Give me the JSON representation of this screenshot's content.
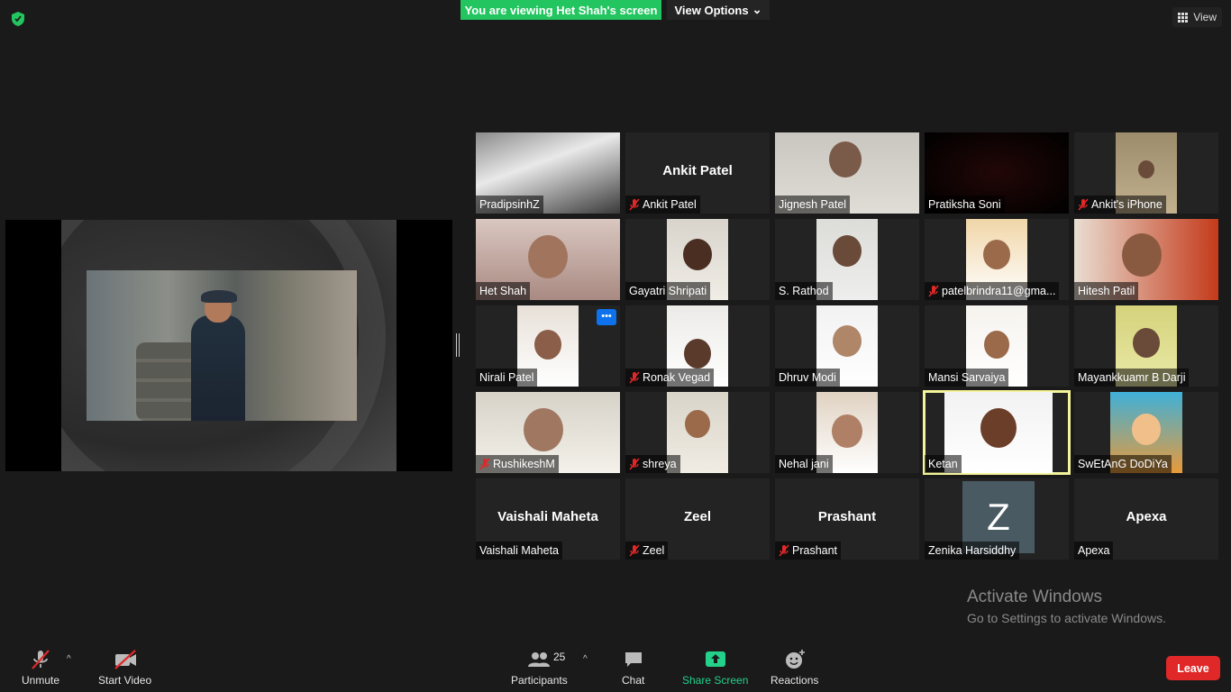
{
  "banner": {
    "text": "You are viewing Het Shah's screen",
    "color": "#23c560"
  },
  "view_options_label": "View Options",
  "view_label": "View",
  "participants": [
    {
      "name": "PradipsinhZ",
      "big": "",
      "muted": false,
      "video": true
    },
    {
      "name": "Ankit Patel",
      "big": "Ankit Patel",
      "muted": true,
      "video": false
    },
    {
      "name": "Jignesh Patel",
      "big": "",
      "muted": false,
      "video": true
    },
    {
      "name": "Pratiksha Soni",
      "big": "",
      "muted": false,
      "video": true
    },
    {
      "name": "Ankit's iPhone",
      "big": "",
      "muted": true,
      "video": true
    },
    {
      "name": "Het Shah",
      "big": "",
      "muted": false,
      "video": true
    },
    {
      "name": "Gayatri Shripati",
      "big": "",
      "muted": false,
      "video": true
    },
    {
      "name": "S. Rathod",
      "big": "",
      "muted": false,
      "video": true
    },
    {
      "name": "patelbrindra11@gma...",
      "big": "",
      "muted": true,
      "video": true
    },
    {
      "name": "Hitesh Patil",
      "big": "",
      "muted": false,
      "video": true
    },
    {
      "name": "Nirali Patel",
      "big": "",
      "muted": false,
      "video": true
    },
    {
      "name": "Ronak Vegad",
      "big": "",
      "muted": true,
      "video": true
    },
    {
      "name": "Dhruv Modi",
      "big": "",
      "muted": false,
      "video": true
    },
    {
      "name": "Mansi Sarvaiya",
      "big": "",
      "muted": false,
      "video": true
    },
    {
      "name": "Mayankkuamr B Darji",
      "big": "",
      "muted": false,
      "video": true
    },
    {
      "name": "RushikeshM",
      "big": "",
      "muted": true,
      "video": true
    },
    {
      "name": "shreya",
      "big": "",
      "muted": true,
      "video": true
    },
    {
      "name": "Nehal jani",
      "big": "",
      "muted": false,
      "video": true
    },
    {
      "name": "Ketan",
      "big": "",
      "muted": false,
      "video": true
    },
    {
      "name": "SwEtAnG DoDiYa",
      "big": "",
      "muted": false,
      "video": true
    },
    {
      "name": "Vaishali Maheta",
      "big": "Vaishali Maheta",
      "muted": false,
      "video": false
    },
    {
      "name": "Zeel",
      "big": "Zeel",
      "muted": true,
      "video": false
    },
    {
      "name": "Prashant",
      "big": "Prashant",
      "muted": true,
      "video": false
    },
    {
      "name": "Zenika Harsiddhy",
      "big": "",
      "avatar_letter": "Z",
      "muted": false,
      "video": false
    },
    {
      "name": "Apexa",
      "big": "Apexa",
      "muted": false,
      "video": false
    }
  ],
  "watermark": {
    "title": "Activate Windows",
    "subtitle": "Go to Settings to activate Windows."
  },
  "toolbar": {
    "unmute": "Unmute",
    "start_video": "Start Video",
    "participants": "Participants",
    "participant_count": "25",
    "chat": "Chat",
    "share_screen": "Share Screen",
    "reactions": "Reactions",
    "leave": "Leave"
  },
  "colors": {
    "accent_green": "#23d18b",
    "leave_red": "#e02828",
    "active_speaker": "#f4f49a"
  }
}
